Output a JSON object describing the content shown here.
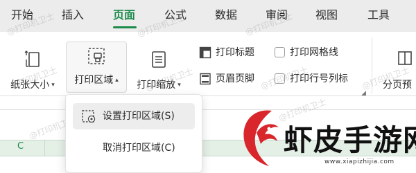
{
  "tabs": [
    {
      "label": "开始"
    },
    {
      "label": "插入"
    },
    {
      "label": "页面",
      "active": true
    },
    {
      "label": "公式"
    },
    {
      "label": "数据"
    },
    {
      "label": "审阅"
    },
    {
      "label": "视图"
    },
    {
      "label": "工具"
    }
  ],
  "ribbon": {
    "paper_size": {
      "label": "纸张大小"
    },
    "print_area": {
      "label": "打印区域"
    },
    "print_scale": {
      "label": "打印缩放"
    },
    "print_titles": {
      "label": "打印标题"
    },
    "header_footer": {
      "label": "页眉页脚"
    },
    "print_gridlines": {
      "label": "打印网格线",
      "checked": false
    },
    "print_row_col": {
      "label": "打印行号列标",
      "checked": false
    },
    "page_break_preview": {
      "label": "分页预"
    }
  },
  "dropdown": {
    "items": [
      {
        "label": "设置打印区域(S)",
        "icon": "set-print-area-icon",
        "highlighted": true
      },
      {
        "label": "取消打印区域(C)"
      }
    ]
  },
  "sheet": {
    "column_header": "C"
  },
  "watermark": {
    "text": "@打印机卫士"
  },
  "logo": {
    "name": "虾皮手游网",
    "url": "www.xiapizhijia.com"
  },
  "colors": {
    "accent": "#1b8a4a",
    "logo_red": "#d9262c",
    "tabbar_bg": "#ececec"
  }
}
